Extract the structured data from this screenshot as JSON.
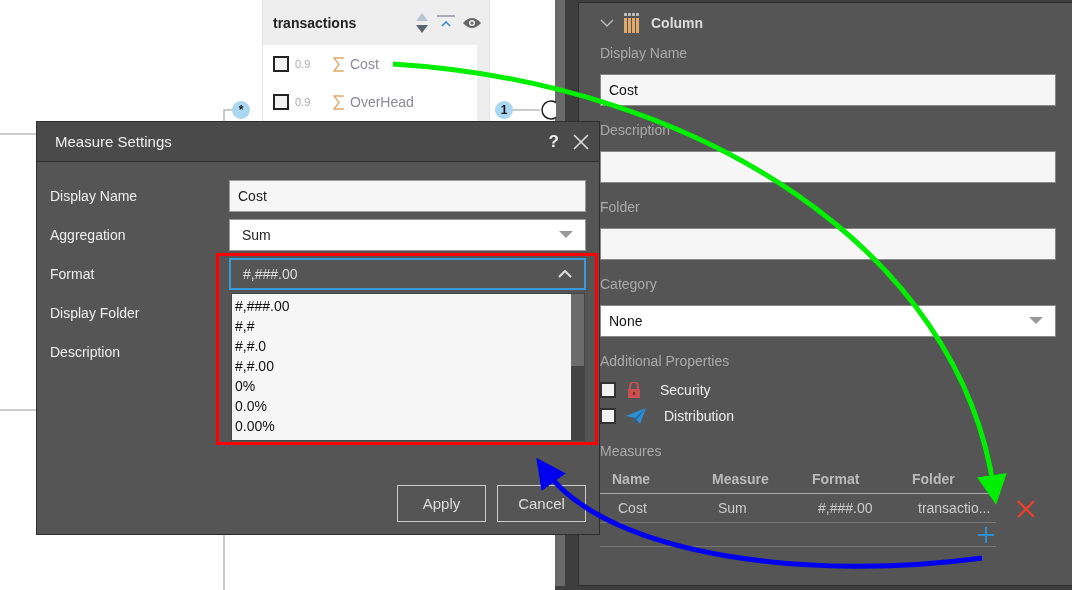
{
  "canvas": {
    "table": {
      "title": "transactions",
      "rows": [
        {
          "checked": false,
          "weight": "0.9",
          "name": "Cost"
        },
        {
          "checked": false,
          "weight": "0.9",
          "name": "OverHead"
        }
      ]
    },
    "badges": [
      "*",
      "1"
    ]
  },
  "dialog": {
    "title": "Measure Settings",
    "help": "?",
    "fields": [
      {
        "label": "Display Name",
        "kind": "text",
        "value": "Cost"
      },
      {
        "label": "Aggregation",
        "kind": "select",
        "value": "Sum"
      },
      {
        "label": "Format",
        "kind": "open-select",
        "value": "#,###.00",
        "options": [
          "#,###.00",
          "#,#",
          "#,#.0",
          "#,#.00",
          "0%",
          "0.0%",
          "0.00%"
        ]
      },
      {
        "label": "Display Folder",
        "kind": "hidden"
      },
      {
        "label": "Description",
        "kind": "hidden"
      }
    ],
    "buttons": [
      "Apply",
      "Cancel"
    ]
  },
  "panel": {
    "title": "Column",
    "expanded": true,
    "fields": [
      {
        "label": "Display Name",
        "kind": "text",
        "value": "Cost"
      },
      {
        "label": "Description",
        "kind": "text"
      },
      {
        "label": "Folder",
        "kind": "text"
      },
      {
        "label": "Category",
        "kind": "select",
        "value": "None"
      }
    ],
    "additional": {
      "label": "Additional Properties",
      "items": [
        {
          "label": "Security",
          "checked": false,
          "kind": "security"
        },
        {
          "label": "Distribution",
          "checked": false,
          "kind": "distribution"
        }
      ]
    },
    "measures": {
      "label": "Measures",
      "columns": [
        "Name",
        "Measure",
        "Format",
        "Folder"
      ],
      "rows": [
        [
          "Cost",
          "Sum",
          "#,###.00",
          "transactio..."
        ]
      ]
    }
  }
}
